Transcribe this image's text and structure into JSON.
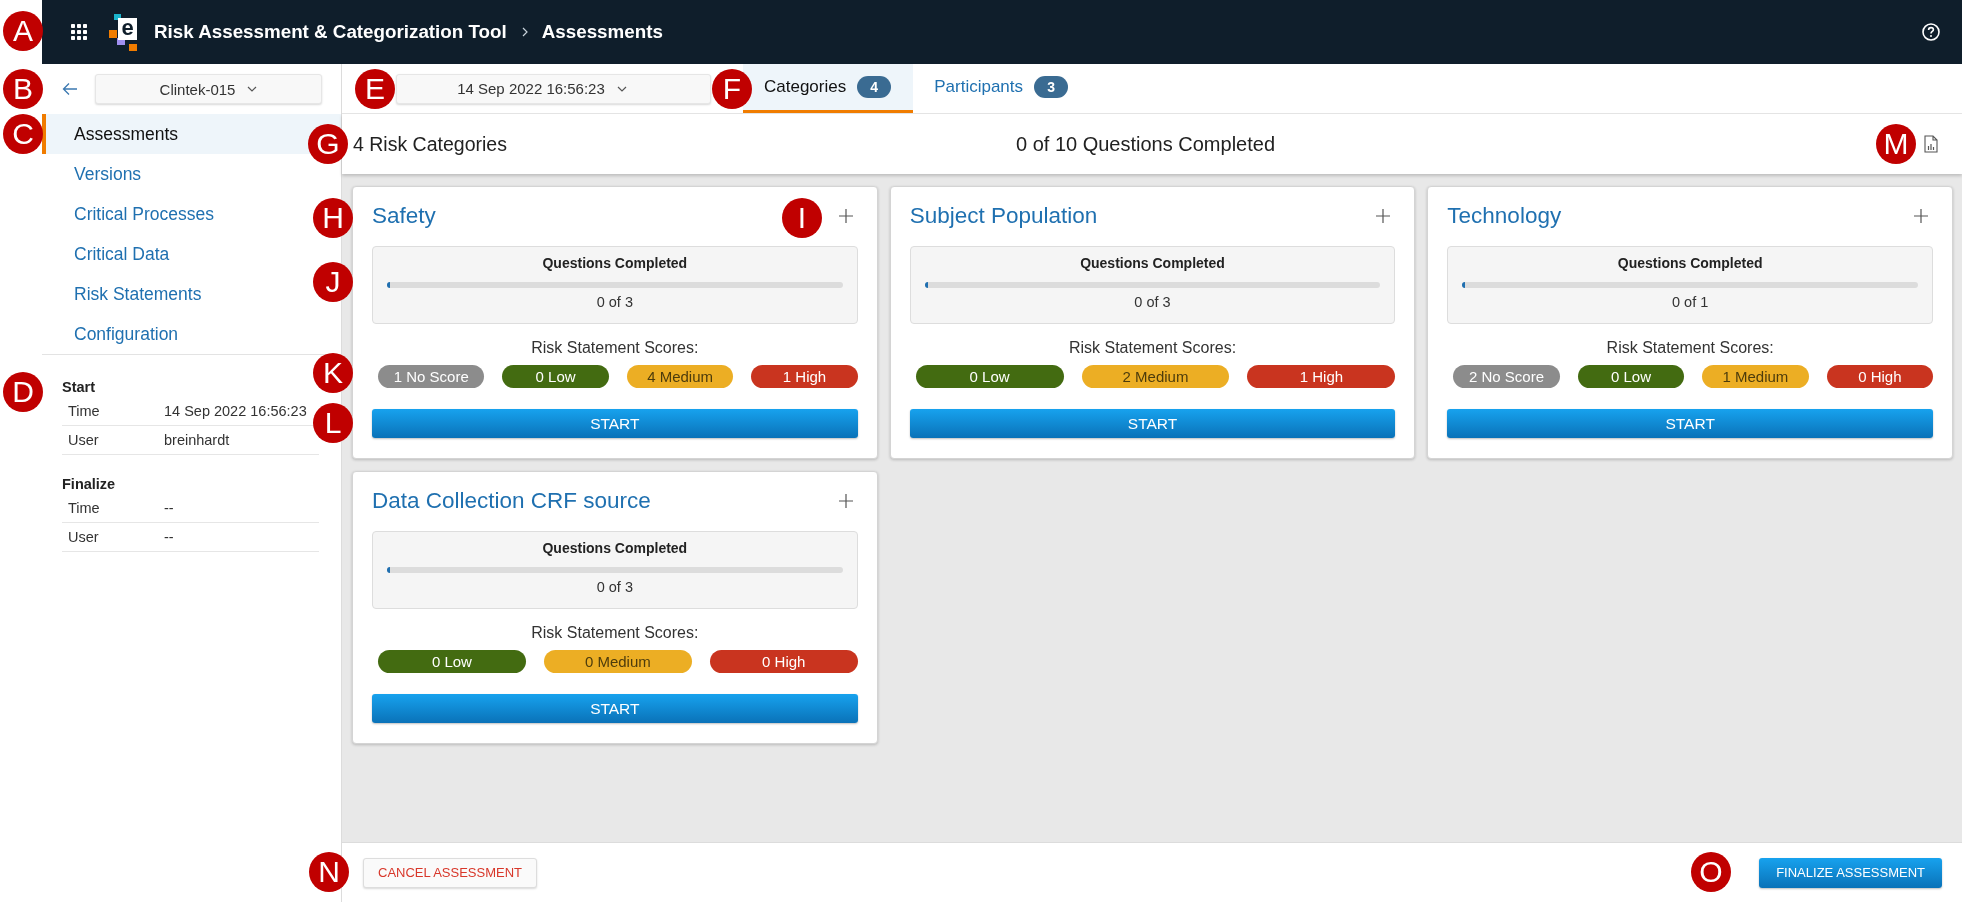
{
  "callouts": [
    {
      "label": "A"
    },
    {
      "label": "B"
    },
    {
      "label": "C"
    },
    {
      "label": "D"
    },
    {
      "label": "E"
    },
    {
      "label": "F"
    },
    {
      "label": "G"
    },
    {
      "label": "H"
    },
    {
      "label": "I"
    },
    {
      "label": "J"
    },
    {
      "label": "K"
    },
    {
      "label": "L"
    },
    {
      "label": "M"
    },
    {
      "label": "N"
    },
    {
      "label": "O"
    }
  ],
  "top_bar": {
    "logo_letter": "e",
    "title": "Risk Assessment & Categorization Tool",
    "breadcrumb": "Assessments"
  },
  "sidebar": {
    "study_select": "Clintek-015",
    "nav_items": [
      {
        "label": "Assessments",
        "selected": true
      },
      {
        "label": "Versions",
        "selected": false
      },
      {
        "label": "Critical Processes",
        "selected": false
      },
      {
        "label": "Critical Data",
        "selected": false
      },
      {
        "label": "Risk Statements",
        "selected": false
      },
      {
        "label": "Configuration",
        "selected": false
      }
    ],
    "sections": [
      {
        "title": "Start",
        "rows": [
          {
            "label": "Time",
            "value": "14 Sep 2022 16:56:23"
          },
          {
            "label": "User",
            "value": "breinhardt"
          }
        ]
      },
      {
        "title": "Finalize",
        "rows": [
          {
            "label": "Time",
            "value": "--"
          },
          {
            "label": "User",
            "value": "--"
          }
        ]
      }
    ]
  },
  "toolbar": {
    "date_select": "14 Sep 2022 16:56:23",
    "tabs": [
      {
        "label": "Categories",
        "count": "4",
        "selected": true
      },
      {
        "label": "Participants",
        "count": "3",
        "selected": false
      }
    ]
  },
  "summary": {
    "categories_count": "4 Risk Categories",
    "questions_summary": "0 of 10 Questions Completed"
  },
  "categories": [
    {
      "title": "Safety",
      "progress_label": "Questions Completed",
      "level": 0,
      "progress_text": "0 of 3",
      "scores_label": "Risk Statement Scores:",
      "scores": [
        {
          "text": "1 No Score",
          "color": "#8c8c8c"
        },
        {
          "text": "0 Low",
          "color": "#436b11"
        },
        {
          "text": "4 Medium",
          "color": "#ecae24"
        },
        {
          "text": "1 High",
          "color": "#c9341f"
        }
      ],
      "action_button": "START"
    },
    {
      "title": "Subject Population",
      "progress_label": "Questions Completed",
      "level": 0,
      "progress_text": "0 of 3",
      "scores_label": "Risk Statement Scores:",
      "scores": [
        {
          "text": "0 Low",
          "color": "#436b11"
        },
        {
          "text": "2 Medium",
          "color": "#ecae24"
        },
        {
          "text": "1 High",
          "color": "#c9341f"
        }
      ],
      "action_button": "START"
    },
    {
      "title": "Technology",
      "progress_label": "Questions Completed",
      "level": 0,
      "progress_text": "0 of 1",
      "scores_label": "Risk Statement Scores:",
      "scores": [
        {
          "text": "2 No Score",
          "color": "#8c8c8c"
        },
        {
          "text": "0 Low",
          "color": "#436b11"
        },
        {
          "text": "1 Medium",
          "color": "#ecae24"
        },
        {
          "text": "0 High",
          "color": "#c9341f"
        }
      ],
      "action_button": "START"
    },
    {
      "title": "Data Collection CRF source",
      "progress_label": "Questions Completed",
      "level": 0,
      "progress_text": "0 of 3",
      "scores_label": "Risk Statement Scores:",
      "scores": [
        {
          "text": "0 Low",
          "color": "#436b11"
        },
        {
          "text": "0 Medium",
          "color": "#ecae24"
        },
        {
          "text": "0 High",
          "color": "#c9341f"
        }
      ],
      "action_button": "START"
    }
  ],
  "footer": {
    "cancel_button": "CANCEL ASSESSMENT",
    "finalize_button": "FINALIZE ASSESSMENT"
  }
}
